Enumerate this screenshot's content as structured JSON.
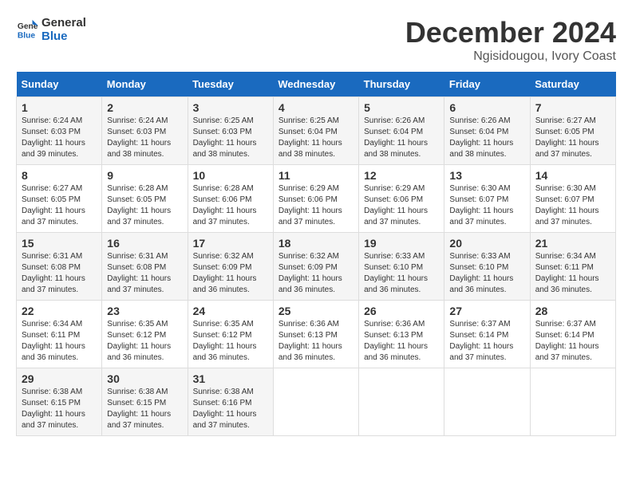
{
  "logo": {
    "line1": "General",
    "line2": "Blue"
  },
  "title": "December 2024",
  "location": "Ngisidougou, Ivory Coast",
  "days_of_week": [
    "Sunday",
    "Monday",
    "Tuesday",
    "Wednesday",
    "Thursday",
    "Friday",
    "Saturday"
  ],
  "weeks": [
    [
      {
        "day": "1",
        "sunrise": "6:24 AM",
        "sunset": "6:03 PM",
        "daylight": "11 hours and 39 minutes."
      },
      {
        "day": "2",
        "sunrise": "6:24 AM",
        "sunset": "6:03 PM",
        "daylight": "11 hours and 38 minutes."
      },
      {
        "day": "3",
        "sunrise": "6:25 AM",
        "sunset": "6:03 PM",
        "daylight": "11 hours and 38 minutes."
      },
      {
        "day": "4",
        "sunrise": "6:25 AM",
        "sunset": "6:04 PM",
        "daylight": "11 hours and 38 minutes."
      },
      {
        "day": "5",
        "sunrise": "6:26 AM",
        "sunset": "6:04 PM",
        "daylight": "11 hours and 38 minutes."
      },
      {
        "day": "6",
        "sunrise": "6:26 AM",
        "sunset": "6:04 PM",
        "daylight": "11 hours and 38 minutes."
      },
      {
        "day": "7",
        "sunrise": "6:27 AM",
        "sunset": "6:05 PM",
        "daylight": "11 hours and 37 minutes."
      }
    ],
    [
      {
        "day": "8",
        "sunrise": "6:27 AM",
        "sunset": "6:05 PM",
        "daylight": "11 hours and 37 minutes."
      },
      {
        "day": "9",
        "sunrise": "6:28 AM",
        "sunset": "6:05 PM",
        "daylight": "11 hours and 37 minutes."
      },
      {
        "day": "10",
        "sunrise": "6:28 AM",
        "sunset": "6:06 PM",
        "daylight": "11 hours and 37 minutes."
      },
      {
        "day": "11",
        "sunrise": "6:29 AM",
        "sunset": "6:06 PM",
        "daylight": "11 hours and 37 minutes."
      },
      {
        "day": "12",
        "sunrise": "6:29 AM",
        "sunset": "6:06 PM",
        "daylight": "11 hours and 37 minutes."
      },
      {
        "day": "13",
        "sunrise": "6:30 AM",
        "sunset": "6:07 PM",
        "daylight": "11 hours and 37 minutes."
      },
      {
        "day": "14",
        "sunrise": "6:30 AM",
        "sunset": "6:07 PM",
        "daylight": "11 hours and 37 minutes."
      }
    ],
    [
      {
        "day": "15",
        "sunrise": "6:31 AM",
        "sunset": "6:08 PM",
        "daylight": "11 hours and 37 minutes."
      },
      {
        "day": "16",
        "sunrise": "6:31 AM",
        "sunset": "6:08 PM",
        "daylight": "11 hours and 37 minutes."
      },
      {
        "day": "17",
        "sunrise": "6:32 AM",
        "sunset": "6:09 PM",
        "daylight": "11 hours and 36 minutes."
      },
      {
        "day": "18",
        "sunrise": "6:32 AM",
        "sunset": "6:09 PM",
        "daylight": "11 hours and 36 minutes."
      },
      {
        "day": "19",
        "sunrise": "6:33 AM",
        "sunset": "6:10 PM",
        "daylight": "11 hours and 36 minutes."
      },
      {
        "day": "20",
        "sunrise": "6:33 AM",
        "sunset": "6:10 PM",
        "daylight": "11 hours and 36 minutes."
      },
      {
        "day": "21",
        "sunrise": "6:34 AM",
        "sunset": "6:11 PM",
        "daylight": "11 hours and 36 minutes."
      }
    ],
    [
      {
        "day": "22",
        "sunrise": "6:34 AM",
        "sunset": "6:11 PM",
        "daylight": "11 hours and 36 minutes."
      },
      {
        "day": "23",
        "sunrise": "6:35 AM",
        "sunset": "6:12 PM",
        "daylight": "11 hours and 36 minutes."
      },
      {
        "day": "24",
        "sunrise": "6:35 AM",
        "sunset": "6:12 PM",
        "daylight": "11 hours and 36 minutes."
      },
      {
        "day": "25",
        "sunrise": "6:36 AM",
        "sunset": "6:13 PM",
        "daylight": "11 hours and 36 minutes."
      },
      {
        "day": "26",
        "sunrise": "6:36 AM",
        "sunset": "6:13 PM",
        "daylight": "11 hours and 36 minutes."
      },
      {
        "day": "27",
        "sunrise": "6:37 AM",
        "sunset": "6:14 PM",
        "daylight": "11 hours and 37 minutes."
      },
      {
        "day": "28",
        "sunrise": "6:37 AM",
        "sunset": "6:14 PM",
        "daylight": "11 hours and 37 minutes."
      }
    ],
    [
      {
        "day": "29",
        "sunrise": "6:38 AM",
        "sunset": "6:15 PM",
        "daylight": "11 hours and 37 minutes."
      },
      {
        "day": "30",
        "sunrise": "6:38 AM",
        "sunset": "6:15 PM",
        "daylight": "11 hours and 37 minutes."
      },
      {
        "day": "31",
        "sunrise": "6:38 AM",
        "sunset": "6:16 PM",
        "daylight": "11 hours and 37 minutes."
      },
      null,
      null,
      null,
      null
    ]
  ]
}
